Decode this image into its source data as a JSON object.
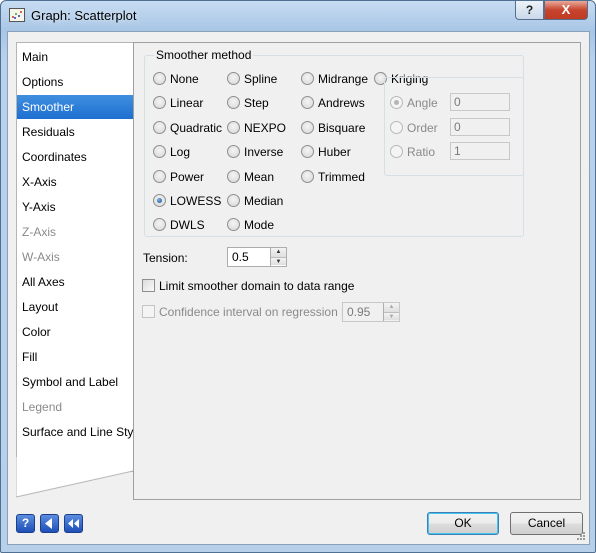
{
  "window": {
    "title": "Graph: Scatterplot"
  },
  "titlebar": {
    "help_label": "?",
    "close_label": "X"
  },
  "sidebar": {
    "items": [
      {
        "label": "Main",
        "state": "normal"
      },
      {
        "label": "Options",
        "state": "normal"
      },
      {
        "label": "Smoother",
        "state": "selected"
      },
      {
        "label": "Residuals",
        "state": "normal"
      },
      {
        "label": "Coordinates",
        "state": "normal"
      },
      {
        "label": "X-Axis",
        "state": "normal"
      },
      {
        "label": "Y-Axis",
        "state": "normal"
      },
      {
        "label": "Z-Axis",
        "state": "disabled"
      },
      {
        "label": "W-Axis",
        "state": "disabled"
      },
      {
        "label": "All Axes",
        "state": "normal"
      },
      {
        "label": "Layout",
        "state": "normal"
      },
      {
        "label": "Color",
        "state": "normal"
      },
      {
        "label": "Fill",
        "state": "normal"
      },
      {
        "label": "Symbol and Label",
        "state": "normal"
      },
      {
        "label": "Legend",
        "state": "disabled"
      },
      {
        "label": "Surface and Line Style",
        "state": "normal"
      }
    ]
  },
  "smoother": {
    "group_label": "Smoother method",
    "methods": {
      "col1": [
        "None",
        "Linear",
        "Quadratic",
        "Log",
        "Power",
        "LOWESS",
        "DWLS"
      ],
      "col2": [
        "Spline",
        "Step",
        "NEXPO",
        "Inverse",
        "Mean",
        "Median",
        "Mode"
      ],
      "col3": [
        "Midrange",
        "Andrews",
        "Bisquare",
        "Huber",
        "Trimmed"
      ],
      "kriging": "Kriging"
    },
    "selected_method": "LOWESS",
    "kriging_options": {
      "angle": {
        "label": "Angle",
        "value": "0"
      },
      "order": {
        "label": "Order",
        "value": "0"
      },
      "ratio": {
        "label": "Ratio",
        "value": "1"
      }
    },
    "tension": {
      "label": "Tension:",
      "value": "0.5"
    },
    "limit_domain": {
      "label": "Limit smoother domain to data range",
      "checked": false
    },
    "confidence": {
      "label": "Confidence interval on regression line",
      "value": "0.95",
      "checked": false,
      "enabled": false
    }
  },
  "footer": {
    "ok_label": "OK",
    "cancel_label": "Cancel",
    "icons": [
      "help-icon",
      "back-icon",
      "first-icon"
    ]
  }
}
